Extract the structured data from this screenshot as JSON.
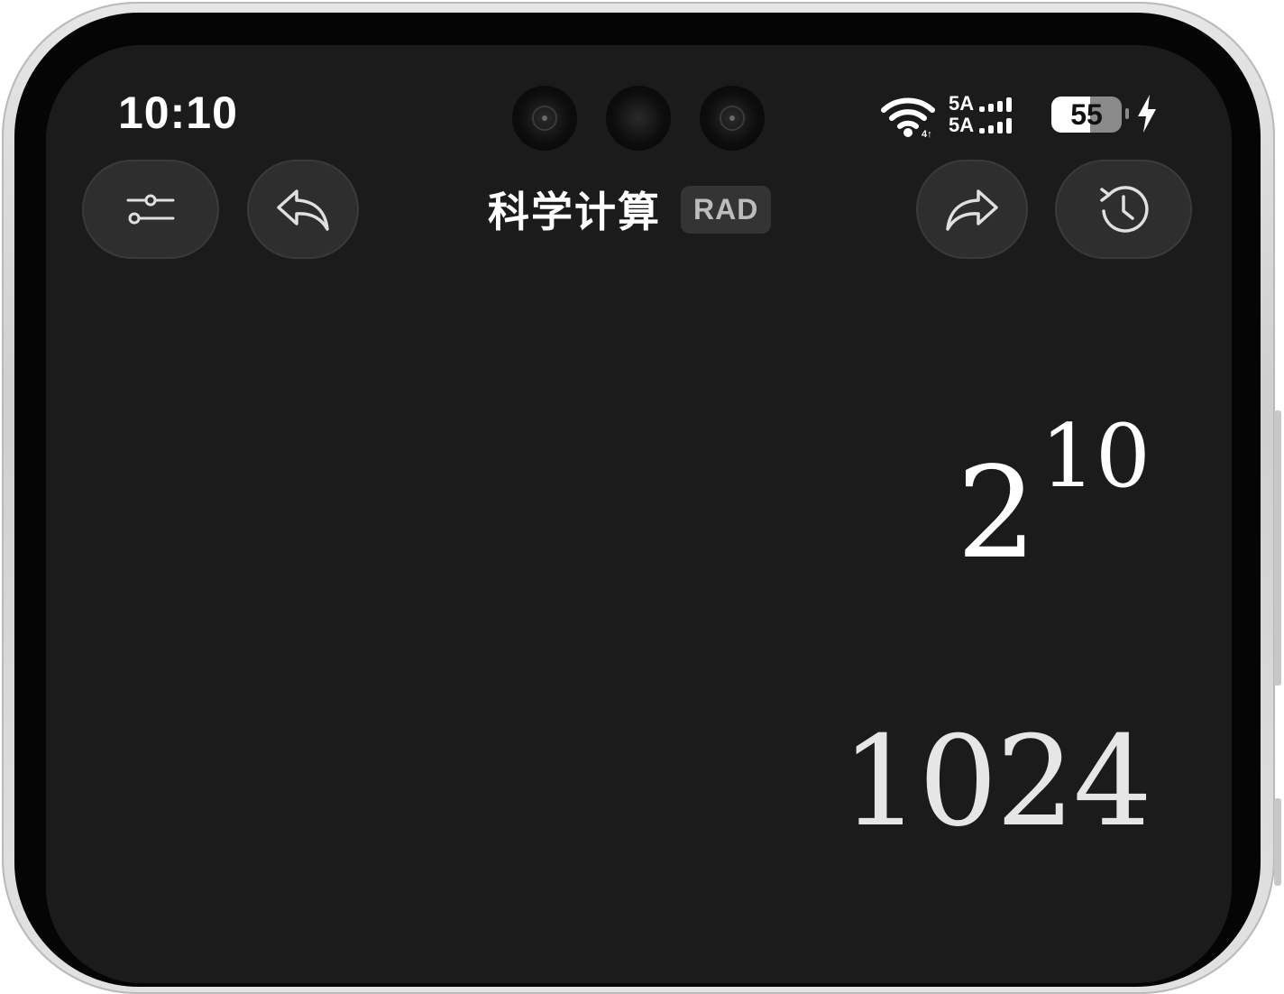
{
  "status_bar": {
    "time": "10:10",
    "network_1": "5A",
    "network_2": "5A",
    "battery_level": "55",
    "battery_fraction": 0.55,
    "charging": true
  },
  "toolbar": {
    "title": "科学计算",
    "angle_mode": "RAD",
    "left_buttons": [
      "settings-sliders-icon",
      "undo-icon"
    ],
    "right_buttons": [
      "redo-icon",
      "history-clock-icon"
    ]
  },
  "display": {
    "expression_base": "2",
    "expression_exponent": "10",
    "result": "1024"
  },
  "colors": {
    "screen_bg": "#1b1b1b",
    "button_bg": "#2e2e2e",
    "text": "#ffffff",
    "badge_bg": "#343434"
  }
}
